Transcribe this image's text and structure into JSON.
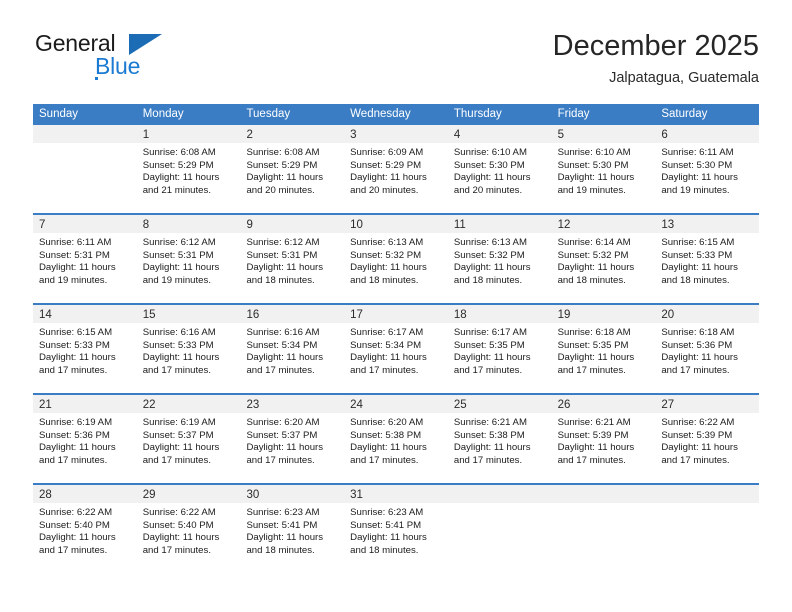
{
  "brand": {
    "word_one": "General",
    "word_two": "Blue",
    "triangle_color": "#1b6cb5",
    "blue_color": "#1b7ad1"
  },
  "header": {
    "title": "December 2025",
    "subtitle": "Jalpatagua, Guatemala"
  },
  "theme": {
    "header_bg": "#3b7dc4",
    "header_text": "#ffffff",
    "daynum_bg": "#f1f1f1",
    "cell_bg": "#ffffff",
    "text": "#1c1c1c"
  },
  "weekdays": [
    "Sunday",
    "Monday",
    "Tuesday",
    "Wednesday",
    "Thursday",
    "Friday",
    "Saturday"
  ],
  "weeks": [
    [
      {
        "day": "",
        "sunrise": "",
        "sunset": "",
        "daylight_line1": "",
        "daylight_line2": ""
      },
      {
        "day": "1",
        "sunrise": "Sunrise: 6:08 AM",
        "sunset": "Sunset: 5:29 PM",
        "daylight_line1": "Daylight: 11 hours",
        "daylight_line2": "and 21 minutes."
      },
      {
        "day": "2",
        "sunrise": "Sunrise: 6:08 AM",
        "sunset": "Sunset: 5:29 PM",
        "daylight_line1": "Daylight: 11 hours",
        "daylight_line2": "and 20 minutes."
      },
      {
        "day": "3",
        "sunrise": "Sunrise: 6:09 AM",
        "sunset": "Sunset: 5:29 PM",
        "daylight_line1": "Daylight: 11 hours",
        "daylight_line2": "and 20 minutes."
      },
      {
        "day": "4",
        "sunrise": "Sunrise: 6:10 AM",
        "sunset": "Sunset: 5:30 PM",
        "daylight_line1": "Daylight: 11 hours",
        "daylight_line2": "and 20 minutes."
      },
      {
        "day": "5",
        "sunrise": "Sunrise: 6:10 AM",
        "sunset": "Sunset: 5:30 PM",
        "daylight_line1": "Daylight: 11 hours",
        "daylight_line2": "and 19 minutes."
      },
      {
        "day": "6",
        "sunrise": "Sunrise: 6:11 AM",
        "sunset": "Sunset: 5:30 PM",
        "daylight_line1": "Daylight: 11 hours",
        "daylight_line2": "and 19 minutes."
      }
    ],
    [
      {
        "day": "7",
        "sunrise": "Sunrise: 6:11 AM",
        "sunset": "Sunset: 5:31 PM",
        "daylight_line1": "Daylight: 11 hours",
        "daylight_line2": "and 19 minutes."
      },
      {
        "day": "8",
        "sunrise": "Sunrise: 6:12 AM",
        "sunset": "Sunset: 5:31 PM",
        "daylight_line1": "Daylight: 11 hours",
        "daylight_line2": "and 19 minutes."
      },
      {
        "day": "9",
        "sunrise": "Sunrise: 6:12 AM",
        "sunset": "Sunset: 5:31 PM",
        "daylight_line1": "Daylight: 11 hours",
        "daylight_line2": "and 18 minutes."
      },
      {
        "day": "10",
        "sunrise": "Sunrise: 6:13 AM",
        "sunset": "Sunset: 5:32 PM",
        "daylight_line1": "Daylight: 11 hours",
        "daylight_line2": "and 18 minutes."
      },
      {
        "day": "11",
        "sunrise": "Sunrise: 6:13 AM",
        "sunset": "Sunset: 5:32 PM",
        "daylight_line1": "Daylight: 11 hours",
        "daylight_line2": "and 18 minutes."
      },
      {
        "day": "12",
        "sunrise": "Sunrise: 6:14 AM",
        "sunset": "Sunset: 5:32 PM",
        "daylight_line1": "Daylight: 11 hours",
        "daylight_line2": "and 18 minutes."
      },
      {
        "day": "13",
        "sunrise": "Sunrise: 6:15 AM",
        "sunset": "Sunset: 5:33 PM",
        "daylight_line1": "Daylight: 11 hours",
        "daylight_line2": "and 18 minutes."
      }
    ],
    [
      {
        "day": "14",
        "sunrise": "Sunrise: 6:15 AM",
        "sunset": "Sunset: 5:33 PM",
        "daylight_line1": "Daylight: 11 hours",
        "daylight_line2": "and 17 minutes."
      },
      {
        "day": "15",
        "sunrise": "Sunrise: 6:16 AM",
        "sunset": "Sunset: 5:33 PM",
        "daylight_line1": "Daylight: 11 hours",
        "daylight_line2": "and 17 minutes."
      },
      {
        "day": "16",
        "sunrise": "Sunrise: 6:16 AM",
        "sunset": "Sunset: 5:34 PM",
        "daylight_line1": "Daylight: 11 hours",
        "daylight_line2": "and 17 minutes."
      },
      {
        "day": "17",
        "sunrise": "Sunrise: 6:17 AM",
        "sunset": "Sunset: 5:34 PM",
        "daylight_line1": "Daylight: 11 hours",
        "daylight_line2": "and 17 minutes."
      },
      {
        "day": "18",
        "sunrise": "Sunrise: 6:17 AM",
        "sunset": "Sunset: 5:35 PM",
        "daylight_line1": "Daylight: 11 hours",
        "daylight_line2": "and 17 minutes."
      },
      {
        "day": "19",
        "sunrise": "Sunrise: 6:18 AM",
        "sunset": "Sunset: 5:35 PM",
        "daylight_line1": "Daylight: 11 hours",
        "daylight_line2": "and 17 minutes."
      },
      {
        "day": "20",
        "sunrise": "Sunrise: 6:18 AM",
        "sunset": "Sunset: 5:36 PM",
        "daylight_line1": "Daylight: 11 hours",
        "daylight_line2": "and 17 minutes."
      }
    ],
    [
      {
        "day": "21",
        "sunrise": "Sunrise: 6:19 AM",
        "sunset": "Sunset: 5:36 PM",
        "daylight_line1": "Daylight: 11 hours",
        "daylight_line2": "and 17 minutes."
      },
      {
        "day": "22",
        "sunrise": "Sunrise: 6:19 AM",
        "sunset": "Sunset: 5:37 PM",
        "daylight_line1": "Daylight: 11 hours",
        "daylight_line2": "and 17 minutes."
      },
      {
        "day": "23",
        "sunrise": "Sunrise: 6:20 AM",
        "sunset": "Sunset: 5:37 PM",
        "daylight_line1": "Daylight: 11 hours",
        "daylight_line2": "and 17 minutes."
      },
      {
        "day": "24",
        "sunrise": "Sunrise: 6:20 AM",
        "sunset": "Sunset: 5:38 PM",
        "daylight_line1": "Daylight: 11 hours",
        "daylight_line2": "and 17 minutes."
      },
      {
        "day": "25",
        "sunrise": "Sunrise: 6:21 AM",
        "sunset": "Sunset: 5:38 PM",
        "daylight_line1": "Daylight: 11 hours",
        "daylight_line2": "and 17 minutes."
      },
      {
        "day": "26",
        "sunrise": "Sunrise: 6:21 AM",
        "sunset": "Sunset: 5:39 PM",
        "daylight_line1": "Daylight: 11 hours",
        "daylight_line2": "and 17 minutes."
      },
      {
        "day": "27",
        "sunrise": "Sunrise: 6:22 AM",
        "sunset": "Sunset: 5:39 PM",
        "daylight_line1": "Daylight: 11 hours",
        "daylight_line2": "and 17 minutes."
      }
    ],
    [
      {
        "day": "28",
        "sunrise": "Sunrise: 6:22 AM",
        "sunset": "Sunset: 5:40 PM",
        "daylight_line1": "Daylight: 11 hours",
        "daylight_line2": "and 17 minutes."
      },
      {
        "day": "29",
        "sunrise": "Sunrise: 6:22 AM",
        "sunset": "Sunset: 5:40 PM",
        "daylight_line1": "Daylight: 11 hours",
        "daylight_line2": "and 17 minutes."
      },
      {
        "day": "30",
        "sunrise": "Sunrise: 6:23 AM",
        "sunset": "Sunset: 5:41 PM",
        "daylight_line1": "Daylight: 11 hours",
        "daylight_line2": "and 18 minutes."
      },
      {
        "day": "31",
        "sunrise": "Sunrise: 6:23 AM",
        "sunset": "Sunset: 5:41 PM",
        "daylight_line1": "Daylight: 11 hours",
        "daylight_line2": "and 18 minutes."
      },
      {
        "day": "",
        "sunrise": "",
        "sunset": "",
        "daylight_line1": "",
        "daylight_line2": ""
      },
      {
        "day": "",
        "sunrise": "",
        "sunset": "",
        "daylight_line1": "",
        "daylight_line2": ""
      },
      {
        "day": "",
        "sunrise": "",
        "sunset": "",
        "daylight_line1": "",
        "daylight_line2": ""
      }
    ]
  ]
}
